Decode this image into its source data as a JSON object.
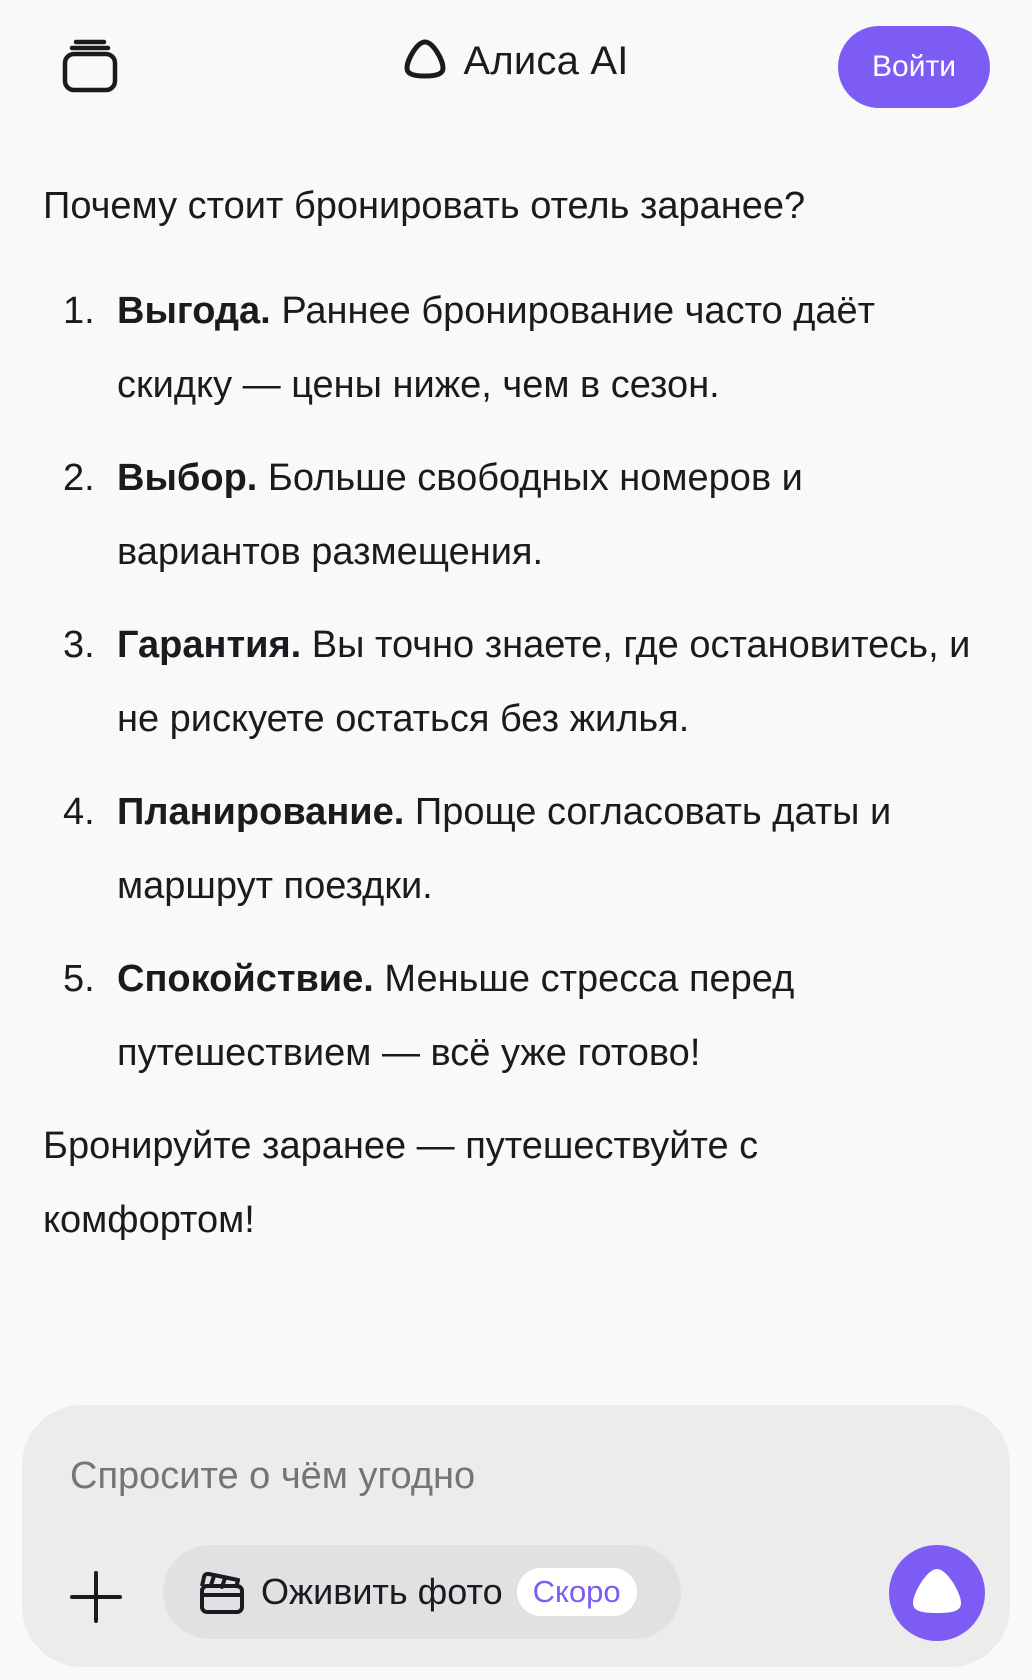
{
  "header": {
    "title": "Алиса AI",
    "login_label": "Войти"
  },
  "chat": {
    "question": "Почему стоит бронировать отель заранее?",
    "items": [
      {
        "num": "1.",
        "title": "Выгода.",
        "text": "Раннее бронирование часто даёт скидку — цены ниже, чем в сезон."
      },
      {
        "num": "2.",
        "title": "Выбор.",
        "text": "Больше свободных номеров и вариантов размещения."
      },
      {
        "num": "3.",
        "title": "Гарантия.",
        "text": "Вы точно знаете, где остановитесь, и не рискуете остаться без жилья."
      },
      {
        "num": "4.",
        "title": "Планирование.",
        "text": "Проще согласовать даты и маршрут поездки."
      },
      {
        "num": "5.",
        "title": "Спокойствие.",
        "text": "Меньше стресса перед путешествием — всё уже готово!"
      }
    ],
    "closing": "Бронируйте заранее — путешествуйте с комфортом!"
  },
  "composer": {
    "placeholder": "Спросите о чём угодно",
    "photo_chip_label": "Оживить фото",
    "soon_badge": "Скоро"
  },
  "icons": {
    "menu": "history-stack-icon",
    "brand": "alice-logo-icon",
    "add": "plus-icon",
    "photo": "clapperboard-icon",
    "voice": "alice-voice-icon"
  },
  "colors": {
    "accent": "#7c5cf5",
    "background": "#f9f9f9",
    "composer": "#ececec",
    "chip": "#e1e1e3",
    "text": "#1b1b1f",
    "placeholder": "#9b9b9f"
  }
}
